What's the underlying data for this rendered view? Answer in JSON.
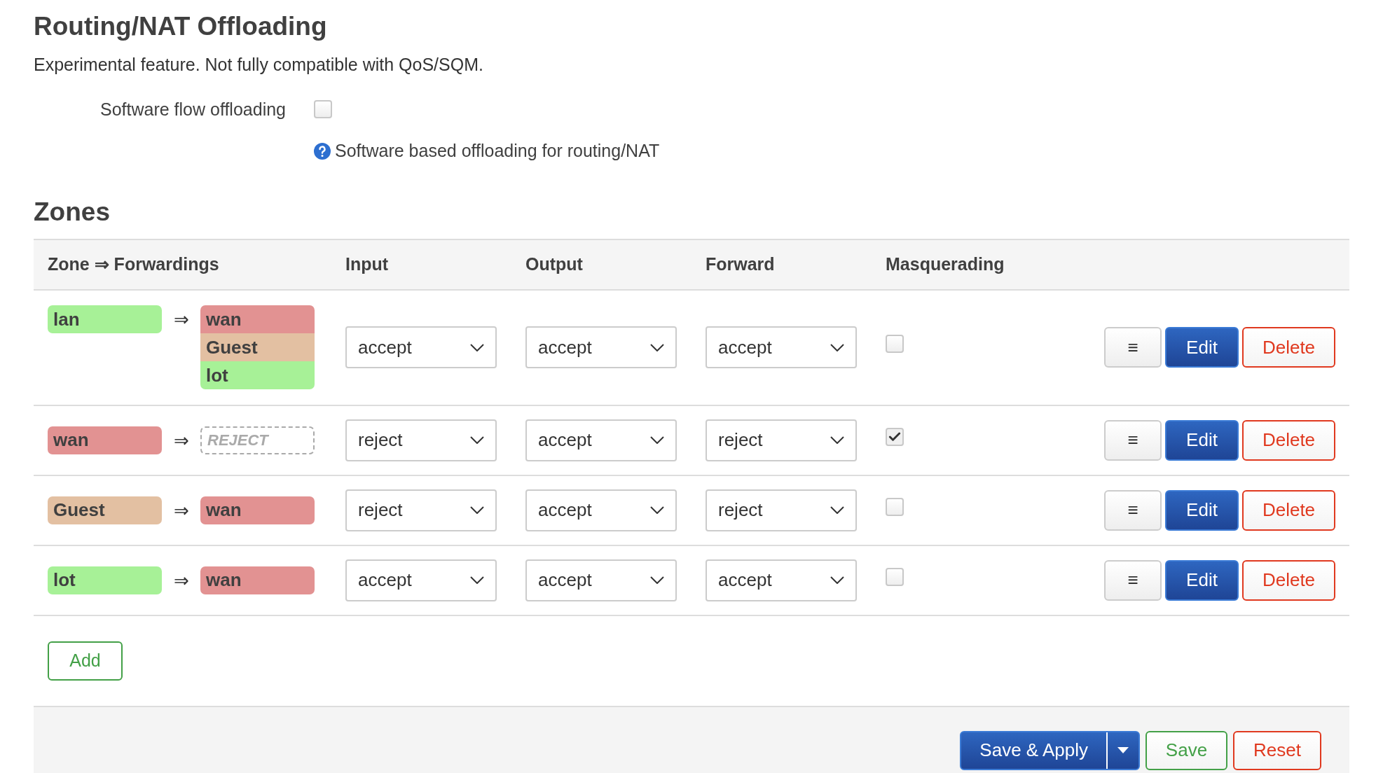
{
  "offloading": {
    "title": "Routing/NAT Offloading",
    "description": "Experimental feature. Not fully compatible with QoS/SQM.",
    "option": {
      "label": "Software flow offloading",
      "checked": false,
      "help": "Software based offloading for routing/NAT"
    }
  },
  "zones": {
    "title": "Zones",
    "columns": [
      "Zone ⇒ Forwardings",
      "Input",
      "Output",
      "Forward",
      "Masquerading"
    ],
    "rows": [
      {
        "zone": {
          "name": "lan",
          "color": "#a7f197"
        },
        "arrow": "⇒",
        "forwardings": [
          {
            "kind": "zone",
            "name": "wan",
            "color": "#e29292"
          },
          {
            "kind": "zone",
            "name": "Guest",
            "color": "#e3c0a2"
          },
          {
            "kind": "zone",
            "name": "lot",
            "color": "#a7f197"
          }
        ],
        "input": "accept",
        "output": "accept",
        "forward": "accept",
        "masquerading": false,
        "actions": [
          "≡",
          "Edit",
          "Delete"
        ]
      },
      {
        "zone": {
          "name": "wan",
          "color": "#e29292"
        },
        "arrow": "⇒",
        "forwardings": [
          {
            "kind": "policy",
            "name": "REJECT"
          }
        ],
        "input": "reject",
        "output": "accept",
        "forward": "reject",
        "masquerading": true,
        "actions": [
          "≡",
          "Edit",
          "Delete"
        ]
      },
      {
        "zone": {
          "name": "Guest",
          "color": "#e3c0a2"
        },
        "arrow": "⇒",
        "forwardings": [
          {
            "kind": "zone",
            "name": "wan",
            "color": "#e29292"
          }
        ],
        "input": "reject",
        "output": "accept",
        "forward": "reject",
        "masquerading": false,
        "actions": [
          "≡",
          "Edit",
          "Delete"
        ]
      },
      {
        "zone": {
          "name": "lot",
          "color": "#a7f197"
        },
        "arrow": "⇒",
        "forwardings": [
          {
            "kind": "zone",
            "name": "wan",
            "color": "#e29292"
          }
        ],
        "input": "accept",
        "output": "accept",
        "forward": "accept",
        "masquerading": false,
        "actions": [
          "≡",
          "Edit",
          "Delete"
        ]
      }
    ],
    "add_button": "Add"
  },
  "footer": {
    "save_apply": "Save & Apply",
    "save": "Save",
    "reset": "Reset"
  }
}
